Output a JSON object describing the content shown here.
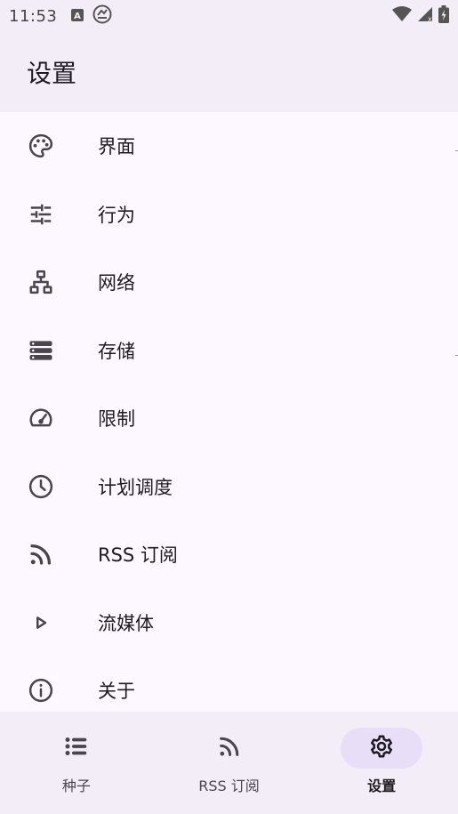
{
  "status_bar": {
    "time": "11:53",
    "icons": [
      "a-notification-icon",
      "sync-icon",
      "wifi-icon",
      "signal-icon",
      "battery-charging-icon"
    ]
  },
  "app_bar": {
    "title": "设置"
  },
  "settings_items": [
    {
      "label": "界面",
      "icon": "palette-icon"
    },
    {
      "label": "行为",
      "icon": "tune-icon"
    },
    {
      "label": "网络",
      "icon": "network-icon"
    },
    {
      "label": "存储",
      "icon": "storage-icon"
    },
    {
      "label": "限制",
      "icon": "speed-icon"
    },
    {
      "label": "计划调度",
      "icon": "clock-icon"
    },
    {
      "label": "RSS 订阅",
      "icon": "rss-icon"
    },
    {
      "label": "流媒体",
      "icon": "play-icon"
    },
    {
      "label": "关于",
      "icon": "info-icon"
    }
  ],
  "bottom_nav": [
    {
      "label": "种子",
      "icon": "list-icon",
      "active": false
    },
    {
      "label": "RSS 订阅",
      "icon": "rss-icon",
      "active": false
    },
    {
      "label": "设置",
      "icon": "gear-icon",
      "active": true
    }
  ],
  "colors": {
    "surface": "#fdf7ff",
    "surface_container": "#f3edf7",
    "active_pill": "#e8def8",
    "icon": "#49454f",
    "text": "#1d1b20"
  }
}
